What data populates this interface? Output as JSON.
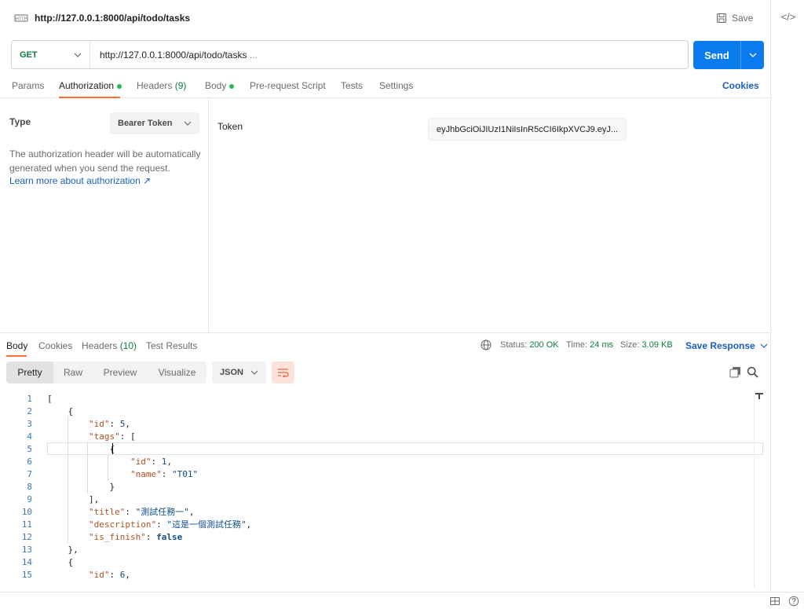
{
  "request": {
    "badge": "HTTP",
    "title": "http://127.0.0.1:8000/api/todo/tasks",
    "save_label": "Save",
    "method": "GET",
    "url": "http://127.0.0.1:8000/api/todo/tasks",
    "url_ellipsis": "...",
    "send_label": "Send"
  },
  "request_tabs": {
    "params": "Params",
    "authorization": "Authorization",
    "headers": "Headers",
    "headers_count": "(9)",
    "body": "Body",
    "prerequest": "Pre-request Script",
    "tests": "Tests",
    "settings": "Settings",
    "cookies": "Cookies"
  },
  "auth": {
    "type_label": "Type",
    "type_value": "Bearer Token",
    "help_text": "The authorization header will be automatically generated when you send the request.",
    "learn_link": "Learn more about authorization ↗",
    "token_label": "Token",
    "token_value": "eyJhbGciOiJIUzI1NiIsInR5cCI6IkpXVCJ9.eyJ...",
    "token_ellipsis": "..."
  },
  "response": {
    "tabs": {
      "body": "Body",
      "cookies": "Cookies",
      "headers": "Headers",
      "headers_count": "(10)",
      "test_results": "Test Results"
    },
    "status_label": "Status:",
    "status_value": "200 OK",
    "time_label": "Time:",
    "time_value": "24 ms",
    "size_label": "Size:",
    "size_value": "3.09 KB",
    "save_response": "Save Response",
    "formats": [
      "Pretty",
      "Raw",
      "Preview",
      "Visualize"
    ],
    "language": "JSON"
  },
  "code_lines": [
    {
      "n": "1",
      "parts": [
        [
          "p",
          "["
        ]
      ]
    },
    {
      "n": "2",
      "parts": [
        [
          "p",
          "    {"
        ]
      ]
    },
    {
      "n": "3",
      "parts": [
        [
          "p",
          "        "
        ],
        [
          "k",
          "\"id\""
        ],
        [
          "p",
          ": "
        ],
        [
          "n",
          "5"
        ],
        [
          "p",
          ","
        ]
      ]
    },
    {
      "n": "4",
      "parts": [
        [
          "p",
          "        "
        ],
        [
          "k",
          "\"tags\""
        ],
        [
          "p",
          ": ["
        ]
      ]
    },
    {
      "n": "5",
      "parts": [
        [
          "p",
          "            {"
        ]
      ]
    },
    {
      "n": "6",
      "parts": [
        [
          "p",
          "                "
        ],
        [
          "k",
          "\"id\""
        ],
        [
          "p",
          ": "
        ],
        [
          "n",
          "1"
        ],
        [
          "p",
          ","
        ]
      ]
    },
    {
      "n": "7",
      "parts": [
        [
          "p",
          "                "
        ],
        [
          "k",
          "\"name\""
        ],
        [
          "p",
          ": "
        ],
        [
          "s",
          "\"T01\""
        ]
      ]
    },
    {
      "n": "8",
      "parts": [
        [
          "p",
          "            }"
        ]
      ]
    },
    {
      "n": "9",
      "parts": [
        [
          "p",
          "        ],"
        ]
      ]
    },
    {
      "n": "10",
      "parts": [
        [
          "p",
          "        "
        ],
        [
          "k",
          "\"title\""
        ],
        [
          "p",
          ": "
        ],
        [
          "s",
          "\"測試任務一\""
        ],
        [
          "p",
          ","
        ]
      ]
    },
    {
      "n": "11",
      "parts": [
        [
          "p",
          "        "
        ],
        [
          "k",
          "\"description\""
        ],
        [
          "p",
          ": "
        ],
        [
          "s",
          "\"這是一個測試任務\""
        ],
        [
          "p",
          ","
        ]
      ]
    },
    {
      "n": "12",
      "parts": [
        [
          "p",
          "        "
        ],
        [
          "k",
          "\"is_finish\""
        ],
        [
          "p",
          ": "
        ],
        [
          "b",
          "false"
        ]
      ]
    },
    {
      "n": "13",
      "parts": [
        [
          "p",
          "    },"
        ]
      ]
    },
    {
      "n": "14",
      "parts": [
        [
          "p",
          "    {"
        ]
      ]
    },
    {
      "n": "15",
      "parts": [
        [
          "p",
          "        "
        ],
        [
          "k",
          "\"id\""
        ],
        [
          "p",
          ": "
        ],
        [
          "n",
          "6"
        ],
        [
          "p",
          ","
        ]
      ]
    }
  ],
  "icons": {
    "http": "http-request-icon",
    "save": "save-icon",
    "code": "code-icon",
    "globe": "globe-icon",
    "copy": "copy-icon",
    "search": "search-icon",
    "wrap": "wrap-lines-icon"
  },
  "colors": {
    "accent": "#ff6c37",
    "primary": "#097bed",
    "link": "#1a5ec4",
    "success": "#0b7d3e"
  }
}
